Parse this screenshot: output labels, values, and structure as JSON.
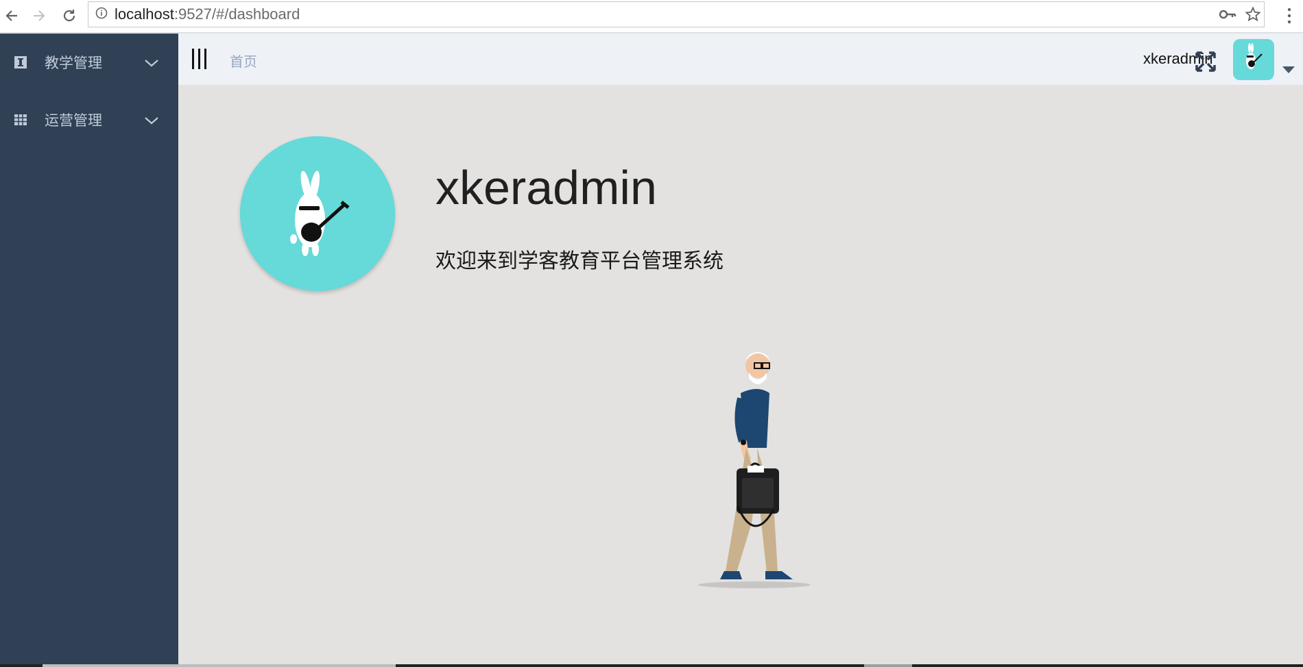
{
  "browser": {
    "url_host": "localhost",
    "url_rest": ":9527/#/dashboard"
  },
  "sidebar": {
    "items": [
      {
        "label": "教学管理",
        "icon": "book-icon"
      },
      {
        "label": "运营管理",
        "icon": "table-icon"
      }
    ]
  },
  "navbar": {
    "breadcrumb": "首页",
    "username": "xkeradmin"
  },
  "main": {
    "profile_name": "xkeradmin",
    "welcome_text": "欢迎来到学客教育平台管理系统"
  },
  "colors": {
    "sidebar_bg": "#304156",
    "navbar_bg": "#eef1f6",
    "main_bg": "#e3e2e1",
    "avatar_bg": "#66d9d9"
  }
}
